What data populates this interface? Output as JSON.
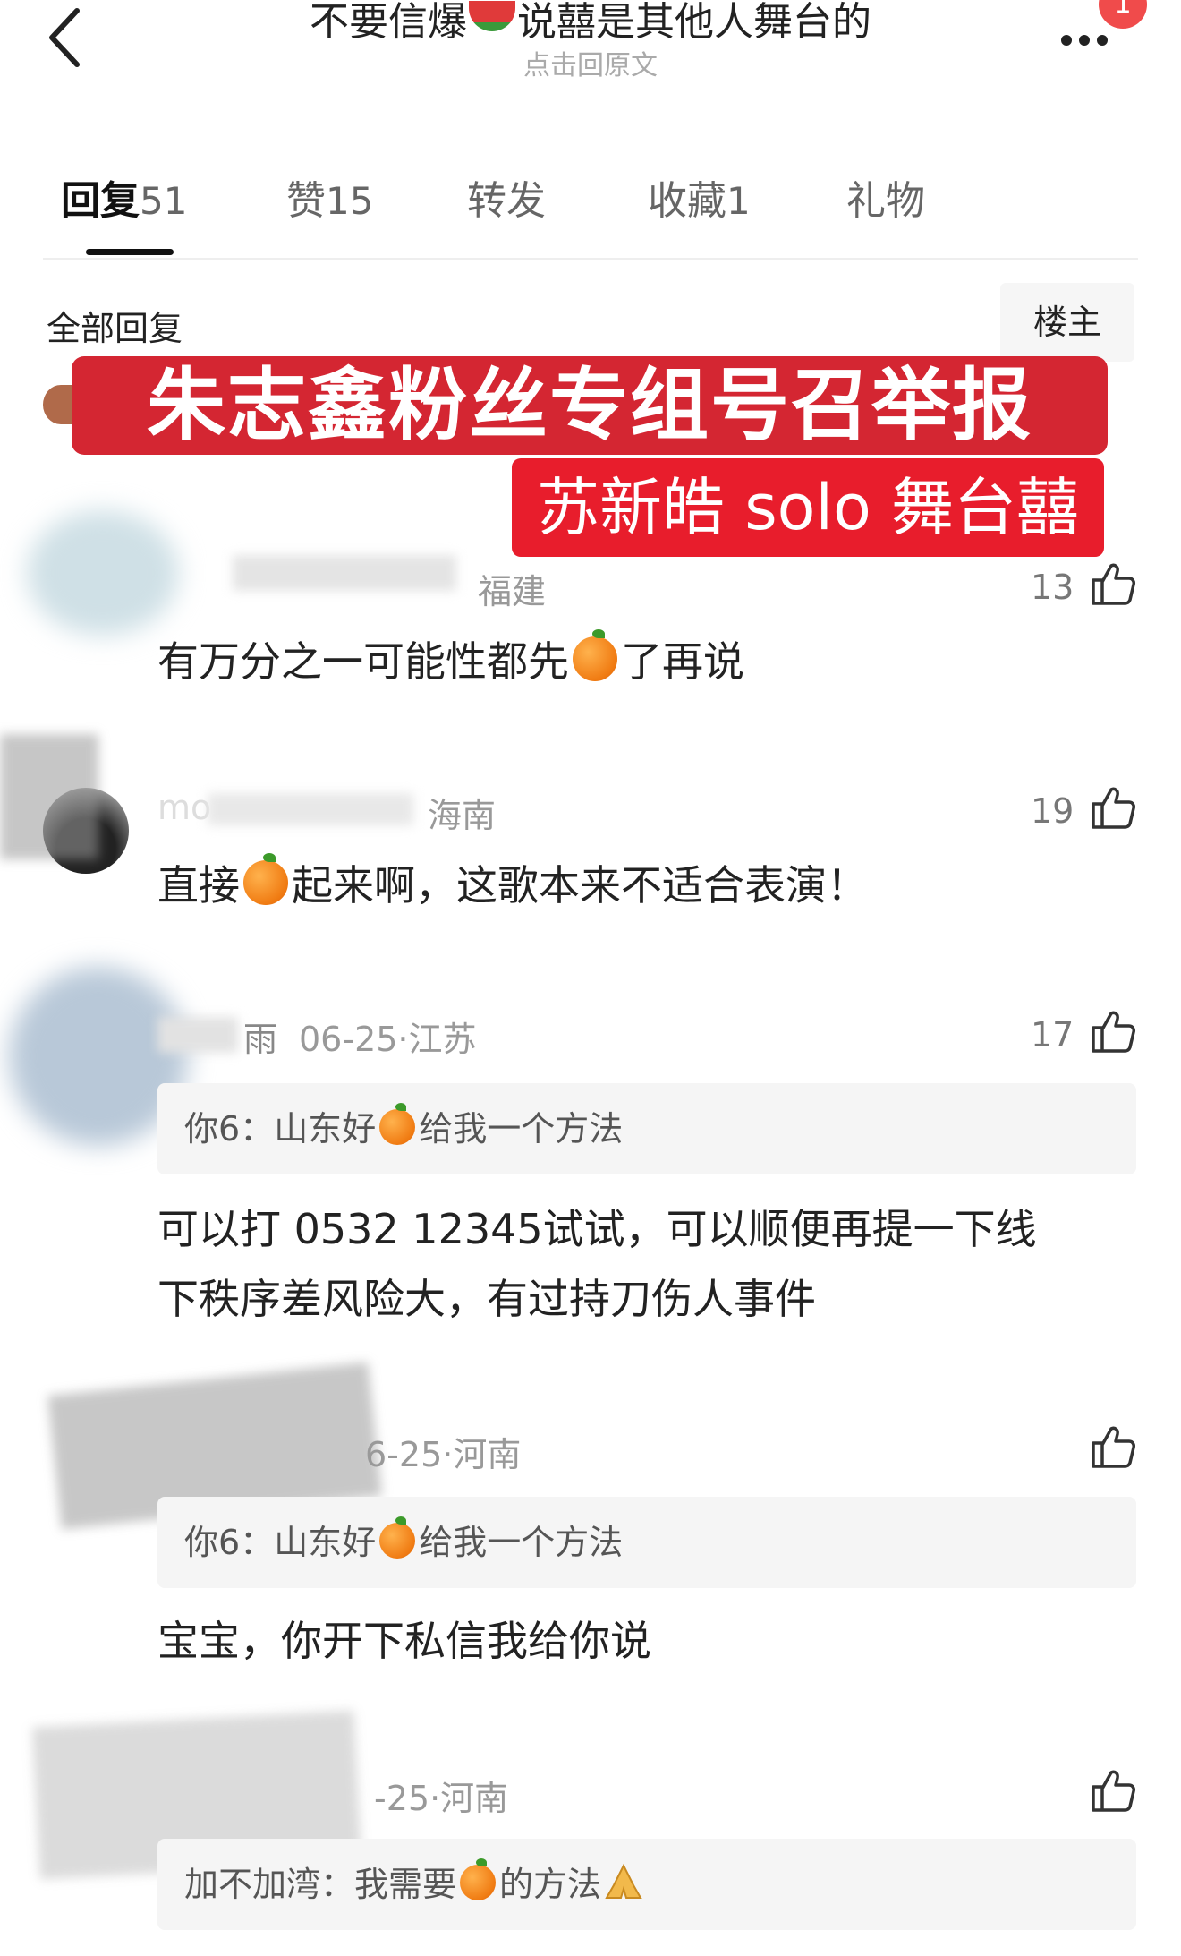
{
  "header": {
    "title_before": "不要信爆",
    "title_after": "说囍是其他人舞台的",
    "title_emoji": "watermelon-emoji",
    "subtitle": "点击回原文",
    "notification_count": "1"
  },
  "tabs": [
    {
      "label": "回复",
      "count": "51"
    },
    {
      "label": "赞",
      "count": "15"
    },
    {
      "label": "转发",
      "count": ""
    },
    {
      "label": "收藏",
      "count": "1"
    },
    {
      "label": "礼物",
      "count": ""
    }
  ],
  "replies_header": "全部回复",
  "op_badge": "楼主",
  "overlay": {
    "line1": "朱志鑫粉丝专组号召举报",
    "line2": "苏新皓 solo 舞台囍"
  },
  "comments": [
    {
      "meta": "福建",
      "likes": "13",
      "text_before": "有万分之一可能性都先",
      "text_after": "了再说"
    },
    {
      "name_partial": "mo",
      "meta": "海南",
      "likes": "19",
      "text_before": "直接",
      "text_after": "起来啊，这歌本来不适合表演！"
    },
    {
      "name_partial": "雨",
      "meta": "06-25·江苏",
      "likes": "17",
      "quote_author": "你6：",
      "quote_before": "山东好",
      "quote_after": "给我一个方法",
      "text_line1": "可以打 0532 12345试试，可以顺便再提一下线",
      "text_line2": "下秩序差风险大，有过持刀伤人事件"
    },
    {
      "meta": "6-25·河南",
      "likes": "",
      "quote_author": "你6：",
      "quote_before": "山东好",
      "quote_after": "给我一个方法",
      "text": "宝宝，你开下私信我给你说"
    },
    {
      "meta": "-25·河南",
      "likes": "",
      "quote_author": "加不加湾：",
      "quote_before": "我需要",
      "quote_after": "的方法"
    }
  ],
  "colors": {
    "banner_red": "#d42632",
    "banner_red2": "#e81d2c",
    "badge_red": "#f04b4b",
    "quote_bg": "#f5f5f5"
  }
}
